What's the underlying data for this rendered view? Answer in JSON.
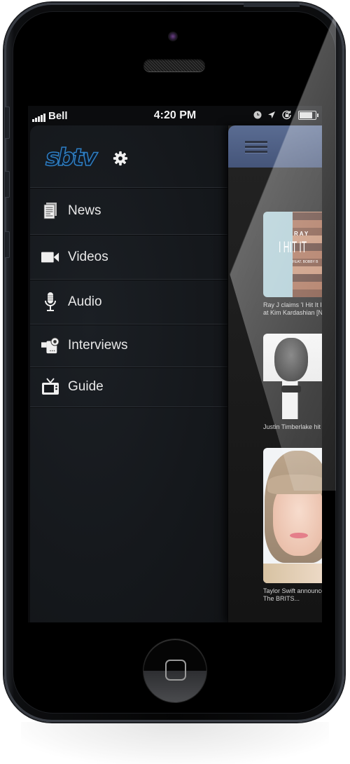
{
  "status_bar": {
    "carrier": "Bell",
    "time": "4:20 PM",
    "icons": [
      "alarm-clock-icon",
      "location-arrow-icon",
      "rotation-lock-icon",
      "battery-icon"
    ],
    "battery_level": 0.9
  },
  "menu": {
    "logo_text": "sbtv",
    "settings_icon": "gear-icon",
    "items": [
      {
        "label": "News",
        "icon": "newspaper-icon"
      },
      {
        "label": "Videos",
        "icon": "video-camera-icon"
      },
      {
        "label": "Audio",
        "icon": "microphone-icon"
      },
      {
        "label": "Interviews",
        "icon": "camcorder-icon"
      },
      {
        "label": "Guide",
        "icon": "tv-icon"
      }
    ]
  },
  "content": {
    "nav_icon": "hamburger-menu-icon",
    "articles": [
      {
        "title_line1": "Ray J claims 'I Hit It I",
        "title_line2": "at Kim Kardashian [N",
        "thumb_text": "I HIT IT",
        "thumb_subtext": "RAY",
        "thumb_feat": "FEAT. BOBBY B"
      },
      {
        "title_line1": "Justin Timberlake hit",
        "title_line2": ""
      },
      {
        "title_line1": "Taylor Swift announce",
        "title_line2": "The BRITS..."
      }
    ]
  },
  "colors": {
    "logo_blue": "#2e7fc4",
    "navbar_blue": "#4f6186",
    "menu_bg": "#16191d"
  }
}
